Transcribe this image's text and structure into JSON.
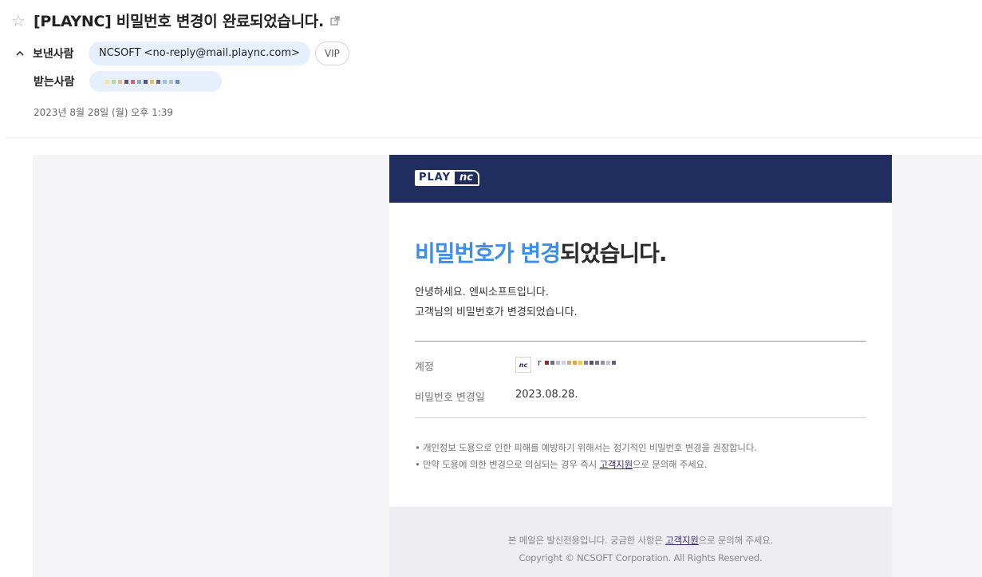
{
  "header": {
    "subject": "[PLAYNC] 비밀번호 변경이 완료되었습니다.",
    "sender_label": "보낸사람",
    "sender": "NCSOFT <no-reply@mail.plaync.com>",
    "vip_label": "VIP",
    "recipient_label": "받는사람",
    "date": "2023년 8월 28일 (월) 오후 1:39"
  },
  "email": {
    "logo_play": "PLAY",
    "logo_nc": "nc",
    "headline_highlight": "비밀번호가 변경",
    "headline_rest": "되었습니다.",
    "greeting_line1": "안녕하세요. 엔씨소프트입니다.",
    "greeting_line2": "고객님의 비밀번호가 변경되었습니다.",
    "account_label": "계정",
    "account_badge": "nc",
    "account_initial": "r",
    "change_date_label": "비밀번호 변경일",
    "change_date": "2023.08.28.",
    "note1": "• 개인정보 도용으로 인한 피해를 예방하기 위해서는 정기적인 비밀번호 변경을 권장합니다.",
    "note2_pre": "• 만약 도용에 의한 변경으로 의심되는 경우 즉시 ",
    "note2_link": "고객지원",
    "note2_post": "으로 문의해 주세요.",
    "footer_pre": "본 메일은 발신전용입니다. 궁금한 사항은 ",
    "footer_link": "고객지원",
    "footer_post": "으로 문의해 주세요.",
    "copyright": "Copyright © NCSOFT Corporation. All Rights Reserved."
  },
  "colors": {
    "brand_navy": "#1f2e5f",
    "headline_blue": "#3b8fe6",
    "chip_bg": "#e6f0fd"
  }
}
